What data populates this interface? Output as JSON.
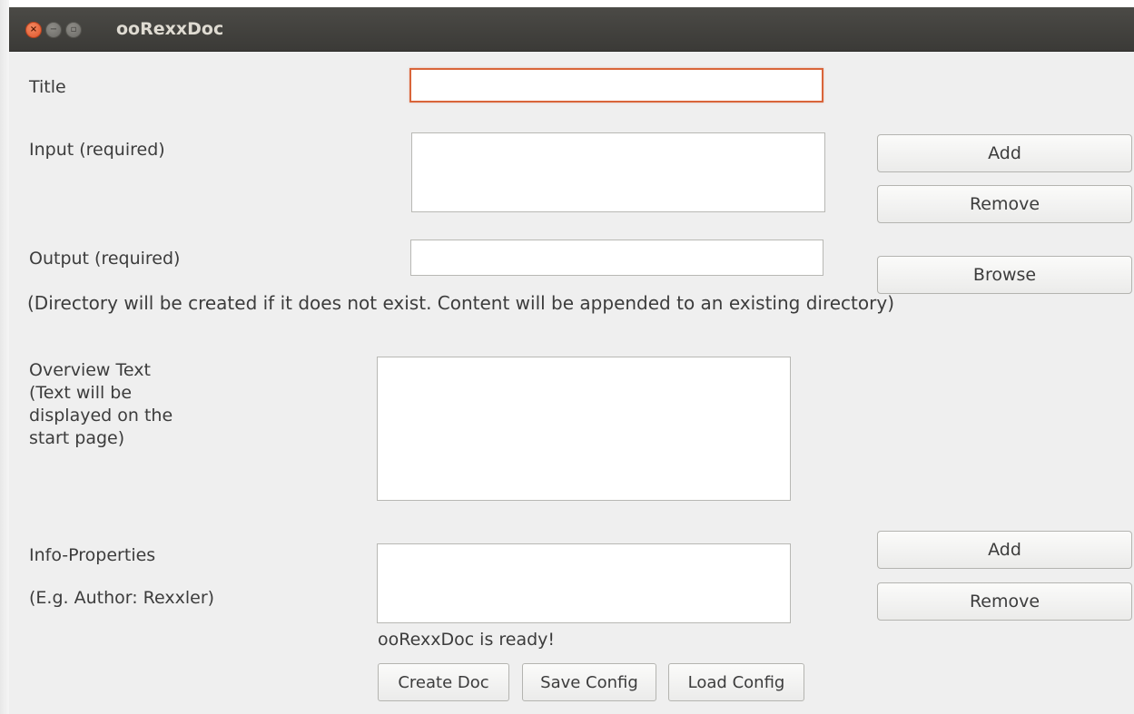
{
  "window": {
    "title": "ooRexxDoc",
    "close_glyph": "×",
    "minimize_glyph": "−",
    "maximize_glyph": "▫"
  },
  "fields": {
    "title_label": "Title",
    "title_value": "",
    "input_label": "Input (required)",
    "input_value": "",
    "output_label": "Output (required)",
    "output_value": "",
    "output_note": "(Directory will be created if it does not exist. Content will be appended to an existing directory)",
    "overview_label_lines": [
      "Overview Text",
      "(Text will be",
      "displayed on the",
      "start page)"
    ],
    "overview_value": "",
    "info_label": "Info-Properties",
    "info_example": "(E.g. Author: Rexxler)",
    "info_value": ""
  },
  "buttons": {
    "input_add": "Add",
    "input_remove": "Remove",
    "output_browse": "Browse",
    "info_add": "Add",
    "info_remove": "Remove",
    "create_doc": "Create Doc",
    "save_config": "Save Config",
    "load_config": "Load Config"
  },
  "status": {
    "message": "ooRexxDoc is ready!"
  },
  "colors": {
    "titlebar": "#3c3b37",
    "window_bg": "#efefef",
    "focus_border": "#d9653a",
    "close_button": "#e95420"
  }
}
